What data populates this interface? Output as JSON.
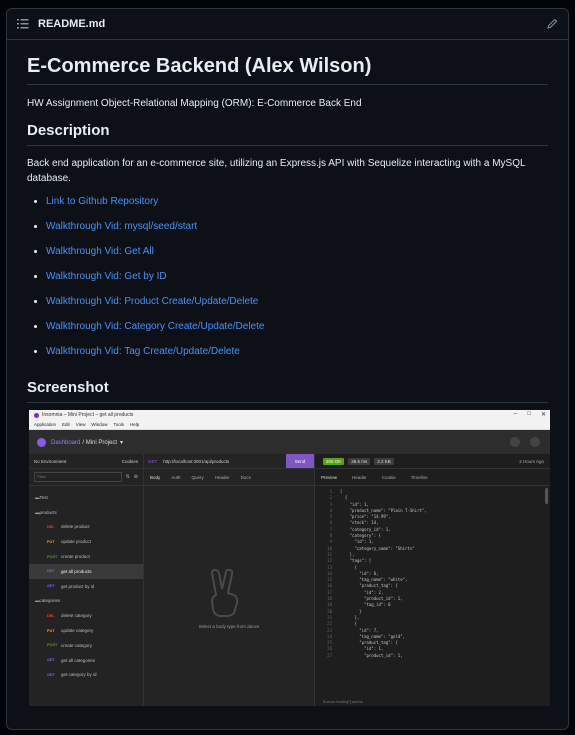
{
  "file": {
    "name": "README.md"
  },
  "readme": {
    "title": "E-Commerce Backend (Alex Wilson)",
    "subtitle": "HW Assignment Object-Relational Mapping (ORM): E-Commerce Back End",
    "description_heading": "Description",
    "description": "Back end application for an e-commerce site, utilizing an Express.js API with Sequelize interacting with a MySQL database.",
    "links": [
      "Link to Github Repository",
      "Walkthrough Vid: mysql/seed/start",
      "Walkthrough Vid: Get All",
      "Walkthrough Vid: Get by ID",
      "Walkthrough Vid: Product Create/Update/Delete",
      "Walkthrough Vid: Category Create/Update/Delete",
      "Walkthrough Vid: Tag Create/Update/Delete"
    ],
    "screenshot_heading": "Screenshot"
  },
  "screenshot": {
    "window_title": "Insomnia – Mini Project – get all products",
    "menu": [
      "Application",
      "Edit",
      "View",
      "Window",
      "Tools",
      "Help"
    ],
    "breadcrumb": "Dashboard",
    "project": "/ Mini Project",
    "env": "No Environment",
    "cookies": "Cookies",
    "filter": "Filter",
    "tree": [
      {
        "kind": "folder",
        "label": "Test"
      },
      {
        "kind": "folder",
        "label": "products"
      },
      {
        "kind": "req",
        "method": "DEL",
        "label": "delete product"
      },
      {
        "kind": "req",
        "method": "PUT",
        "label": "update product"
      },
      {
        "kind": "req",
        "method": "POST",
        "label": "create product"
      },
      {
        "kind": "req",
        "method": "GET",
        "label": "get all products",
        "selected": true
      },
      {
        "kind": "req",
        "method": "GET",
        "label": "get product by id"
      },
      {
        "kind": "folder",
        "label": "categories"
      },
      {
        "kind": "req",
        "method": "DEL",
        "label": "delete category"
      },
      {
        "kind": "req",
        "method": "PUT",
        "label": "update category"
      },
      {
        "kind": "req",
        "method": "POST",
        "label": "create category"
      },
      {
        "kind": "req",
        "method": "GET",
        "label": "get all categories"
      },
      {
        "kind": "req",
        "method": "GET",
        "label": "get category by id"
      }
    ],
    "method": "GET",
    "url": "http://localhost:3001/api/products",
    "send": "Send",
    "req_tabs": [
      "Body",
      "Auth",
      "Query",
      "Header",
      "Docs"
    ],
    "empty_hint": "Select a body type from above",
    "status": "200 OK",
    "time": "36.6 ms",
    "size": "2.2 KB",
    "ago": "2 Hours Ago",
    "resp_tabs": [
      "Preview",
      "Header",
      "Cookie",
      "Timeline"
    ],
    "code": [
      "[",
      "  {",
      "    \"id\": 1,",
      "    \"product_name\": \"Plain T-Shirt\",",
      "    \"price\": \"14.99\",",
      "    \"stock\": 14,",
      "    \"category_id\": 1,",
      "    \"category\": {",
      "      \"id\": 1,",
      "      \"category_name\": \"Shirts\"",
      "    },",
      "    \"tags\": [",
      "      {",
      "        \"id\": 6,",
      "        \"tag_name\": \"white\",",
      "        \"product_tag\": {",
      "          \"id\": 2,",
      "          \"product_id\": 1,",
      "          \"tag_id\": 6",
      "        }",
      "      },",
      "      {",
      "        \"id\": 7,",
      "        \"tag_name\": \"gold\",",
      "        \"product_tag\": {",
      "          \"id\": 1,",
      "          \"product_id\": 1,"
    ],
    "footer": "$.store.books[*].author",
    "colors": {
      "get": "#8d5ae5",
      "post": "#59a210",
      "put": "#ff9a1f",
      "del": "#e5453e"
    }
  }
}
